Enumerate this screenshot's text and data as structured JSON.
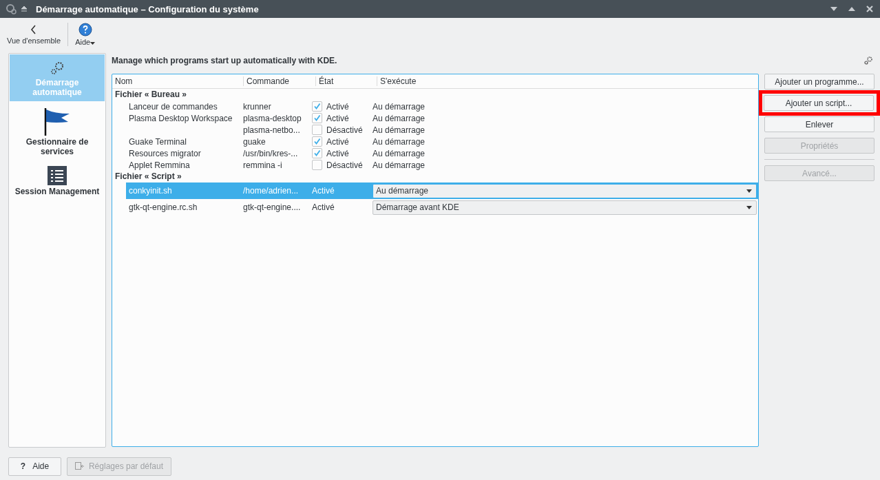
{
  "window": {
    "title": "Démarrage automatique – Configuration du système"
  },
  "toolbar": {
    "back": {
      "label": "Vue d'ensemble"
    },
    "help": {
      "label": "Aide"
    }
  },
  "sidebar": {
    "items": [
      {
        "label": "Démarrage automatique",
        "selected": true
      },
      {
        "label": "Gestionnaire de services",
        "selected": false
      },
      {
        "label": "Session Management",
        "selected": false
      }
    ]
  },
  "heading": "Manage which programs start up automatically with KDE.",
  "table": {
    "columns": [
      "Nom",
      "Commande",
      "État",
      "S'exécute"
    ],
    "groups": [
      {
        "label": "Fichier « Bureau »",
        "children": [
          {
            "kind": "checkbox",
            "name": "Lanceur de commandes",
            "command": "krunner",
            "checked": true,
            "state": "Activé",
            "run": "Au démarrage",
            "selected": false
          },
          {
            "kind": "checkbox",
            "name": "Plasma Desktop Workspace",
            "command": "plasma-desktop",
            "checked": true,
            "state": "Activé",
            "run": "Au démarrage",
            "selected": false
          },
          {
            "kind": "checkbox",
            "command": "plasma-netbo...",
            "checked": false,
            "state": "Désactivé",
            "run": "Au démarrage",
            "selected": false
          },
          {
            "kind": "checkbox",
            "name": "Guake Terminal",
            "command": "guake",
            "checked": true,
            "state": "Activé",
            "run": "Au démarrage",
            "selected": false
          },
          {
            "kind": "checkbox",
            "name": "Resources migrator",
            "command": "/usr/bin/kres-...",
            "checked": true,
            "state": "Activé",
            "run": "Au démarrage",
            "selected": false
          },
          {
            "kind": "checkbox",
            "name": "Applet Remmina",
            "command": "remmina -i",
            "checked": false,
            "state": "Désactivé",
            "run": "Au démarrage",
            "selected": false
          }
        ]
      },
      {
        "label": "Fichier « Script »",
        "children": [
          {
            "kind": "dropdown",
            "name": "conkyinit.sh",
            "command": "/home/adrien...",
            "state": "Activé",
            "run": "Au démarrage",
            "selected": true
          },
          {
            "kind": "dropdown",
            "name": "gtk-qt-engine.rc.sh",
            "command": "gtk-qt-engine....",
            "state": "Activé",
            "run": "Démarrage avant KDE",
            "selected": false
          }
        ]
      }
    ]
  },
  "actions": [
    {
      "label": "Ajouter un programme...",
      "disabled": false,
      "highlighted": false
    },
    {
      "label": "Ajouter un script...",
      "disabled": false,
      "highlighted": true
    },
    {
      "label": "Enlever",
      "disabled": false,
      "highlighted": false
    },
    {
      "label": "Propriétés",
      "disabled": true,
      "highlighted": false
    },
    {
      "label": "Avancé...",
      "disabled": true,
      "highlighted": false
    }
  ],
  "footer": [
    {
      "label": "Aide",
      "icon": "?",
      "disabled": false
    },
    {
      "label": "Réglages par défaut",
      "disabled": true
    }
  ]
}
